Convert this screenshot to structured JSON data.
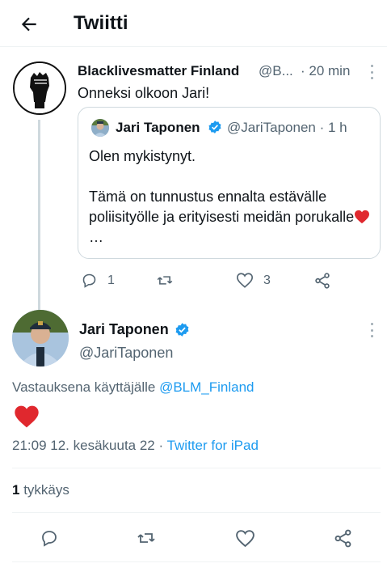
{
  "header": {
    "title": "Twiitti"
  },
  "parent_tweet": {
    "name": "Blacklivesmatter Finland",
    "handle": "@B...",
    "time": "· 20 min",
    "text": "Onneksi olkoon Jari!",
    "quote": {
      "name": "Jari Taponen",
      "handle": "@JariTaponen · 1 h",
      "line1": "Olen mykistynyt.",
      "line2": "Tämä on tunnustus ennalta estävälle poliisityölle ja erityisesti meidän porukalle",
      "line2_suffix": "…"
    },
    "actions": {
      "replies": "1",
      "likes": "3"
    }
  },
  "main_tweet": {
    "name": "Jari Taponen",
    "handle": "@JariTaponen",
    "reply_prefix": "Vastauksena käyttäjälle ",
    "reply_mention": "@BLM_Finland",
    "timestamp": "21:09 12. kesäkuuta 22 · ",
    "source": "Twitter for iPad",
    "likes_count": "1",
    "likes_label": " tykkäys"
  },
  "icons": {
    "back": "arrow-left-icon",
    "more": "more-vertical-icon",
    "reply": "reply-icon",
    "retweet": "retweet-icon",
    "like": "heart-outline-icon",
    "share": "share-icon",
    "verified": "verified-badge-icon",
    "emoji_heart": "red-heart-emoji"
  },
  "colors": {
    "accent": "#1d9bf0",
    "heart": "#e0282e",
    "muted": "#536471"
  }
}
